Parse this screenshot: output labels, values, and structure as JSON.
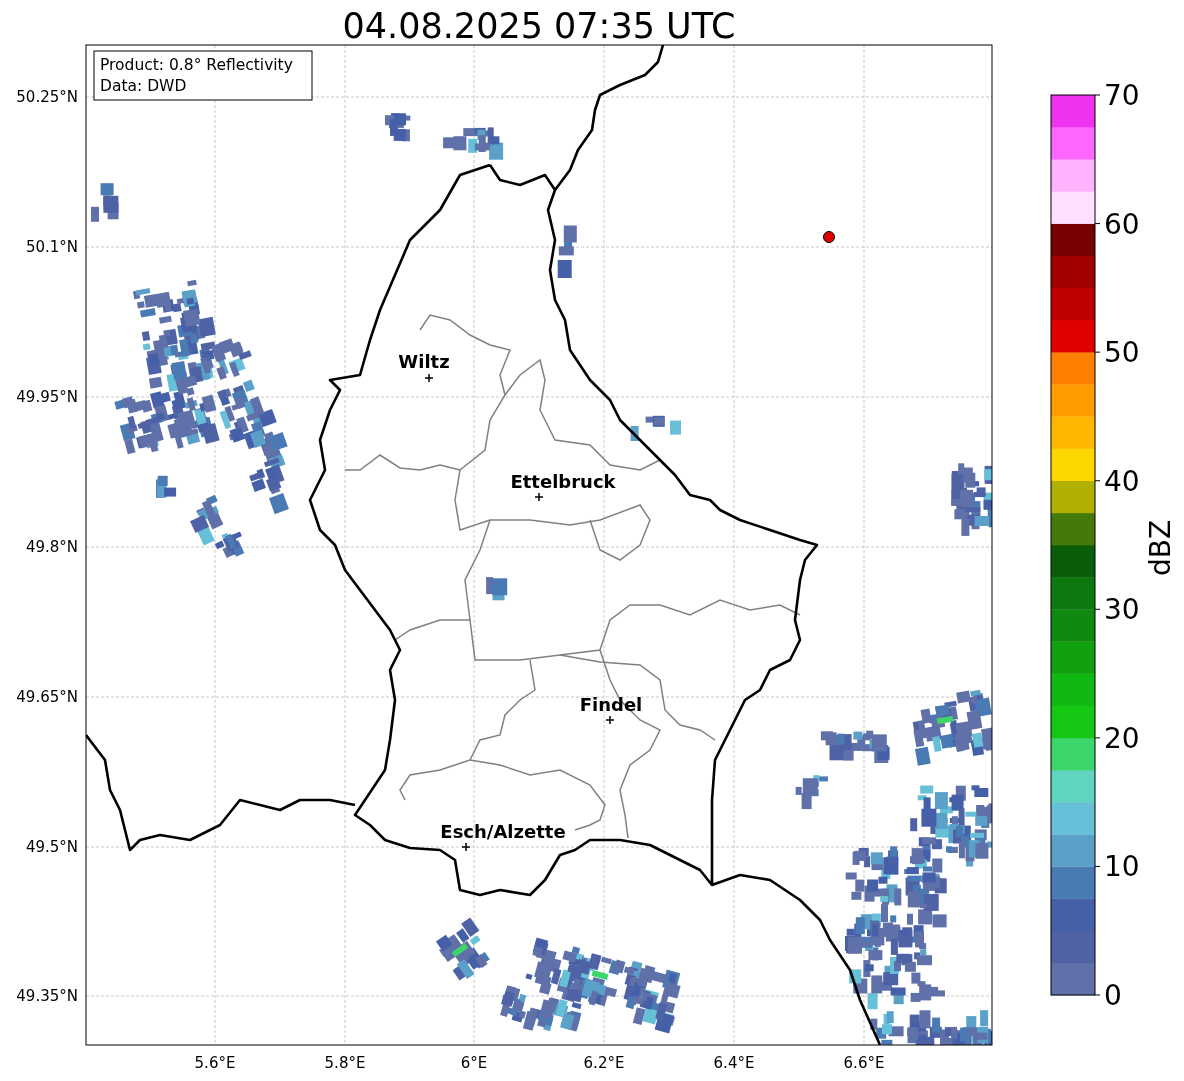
{
  "title": "04.08.2025 07:35 UTC",
  "info_box": [
    "Product: 0.8° Reflectivity",
    "Data: DWD"
  ],
  "lat_ticks": [
    "50.25°N",
    "50.1°N",
    "49.95°N",
    "49.8°N",
    "49.65°N",
    "49.5°N",
    "49.35°N"
  ],
  "lon_ticks": [
    "5.6°E",
    "5.8°E",
    "6°E",
    "6.2°E",
    "6.4°E",
    "6.6°E"
  ],
  "cities": [
    {
      "name": "Wiltz"
    },
    {
      "name": "Ettelbruck"
    },
    {
      "name": "Findel"
    },
    {
      "name": "Esch/Alzette"
    }
  ],
  "colorbar": {
    "label": "dBZ",
    "ticks": [
      "70",
      "60",
      "50",
      "40",
      "30",
      "20",
      "10",
      "0"
    ],
    "bins": [
      {
        "color": "#6070a8"
      },
      {
        "color": "#4e62a5"
      },
      {
        "color": "#4560a8"
      },
      {
        "color": "#4a7ab4"
      },
      {
        "color": "#5aa0c8"
      },
      {
        "color": "#66c0d8"
      },
      {
        "color": "#5fd5c0"
      },
      {
        "color": "#3dd46a"
      },
      {
        "color": "#14c814"
      },
      {
        "color": "#12b812"
      },
      {
        "color": "#10a010"
      },
      {
        "color": "#0f8a0f"
      },
      {
        "color": "#0d780d"
      },
      {
        "color": "#0a5e0a"
      },
      {
        "color": "#457a0a"
      },
      {
        "color": "#b0b000"
      },
      {
        "color": "#ffd700"
      },
      {
        "color": "#ffb800"
      },
      {
        "color": "#ff9c00"
      },
      {
        "color": "#ff8000"
      },
      {
        "color": "#e00000"
      },
      {
        "color": "#c00000"
      },
      {
        "color": "#a00000"
      },
      {
        "color": "#780000"
      },
      {
        "color": "#ffe0ff"
      },
      {
        "color": "#ffb3ff"
      },
      {
        "color": "#ff66ff"
      },
      {
        "color": "#ee33ee"
      }
    ]
  }
}
